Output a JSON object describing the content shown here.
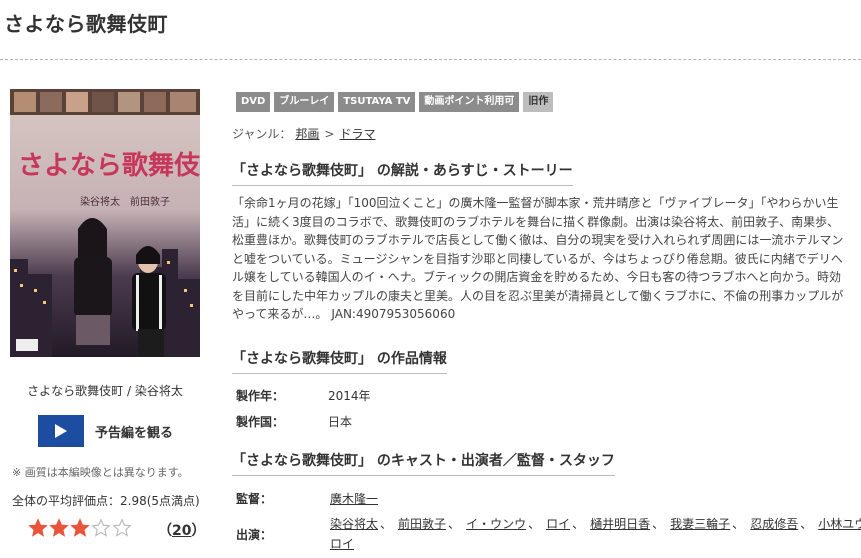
{
  "page": {
    "title": "さよなら歌舞伎町"
  },
  "cover": {
    "poster_title": "さよなら歌舞伎町",
    "poster_cast": "染谷将太　前田敦子",
    "caption": "さよなら歌舞伎町 / 染谷将太",
    "trailer_label": "予告編を観る",
    "image_note": "※ 画質は本編映像とは異なります。"
  },
  "rating": {
    "summary": "全体の平均評価点：2.98(5点満点)",
    "stars_filled": 3,
    "stars_total": 5,
    "review_count_open": "（",
    "review_count": "20",
    "review_count_close": "）",
    "star_color": "#e8553a"
  },
  "tags": [
    "DVD",
    "ブルーレイ",
    "TSUTAYA TV",
    "動画ポイント利用可",
    "旧作"
  ],
  "genre": {
    "label": "ジャンル：",
    "items": [
      "邦画",
      "ドラマ"
    ],
    "separator": ">"
  },
  "synopsis": {
    "heading": "「さよなら歌舞伎町」 の解説・あらすじ・ストーリー",
    "lines": [
      "「余命1ヶ月の花嫁」「100回泣くこと」の廣木隆一監督が脚本家・荒井晴彦と「ヴァイブレータ」「やわらかい生",
      "活」に続く3度目のコラボで、歌舞伎町のラブホテルを舞台に描く群像劇。出演は染谷将太、前田敦子、南果歩、",
      "松重豊ほか。歌舞伎町のラブホテルで店長として働く徹は、自分の現実を受け入れられず周囲には一流ホテルマン",
      "と嘘をついている。ミュージシャンを目指す沙耶と同棲しているが、今はちょっぴり倦怠期。彼氏に内緒でデリヘ",
      "ル嬢をしている韓国人のイ・ヘナ。ブティックの開店資金を貯めるため、今日も客の待つラブホへと向かう。時効",
      "を目前にした中年カップルの康夫と里美。人の目を忍ぶ里美が清掃員として働くラブホに、不倫の刑事カップルが"
    ],
    "last_line": "やって来るが…。",
    "jan": "JAN:4907953056060"
  },
  "work_info": {
    "heading": "「さよなら歌舞伎町」 の作品情報",
    "rows": [
      {
        "label": "製作年：",
        "value": "2014年"
      },
      {
        "label": "製作国：",
        "value": "日本"
      }
    ]
  },
  "cast": {
    "heading": "「さよなら歌舞伎町」 のキャスト・出演者／監督・スタッフ",
    "director_label": "監督：",
    "director": "廣木隆一",
    "actors_label": "出演：",
    "actors": [
      "染谷将太",
      "前田敦子",
      "イ・ウンウ",
      "ロイ",
      "樋井明日香",
      "我妻三輪子",
      "忍成修吾",
      "小林ユウキチ",
      "ロイ"
    ],
    "comma": "、"
  }
}
